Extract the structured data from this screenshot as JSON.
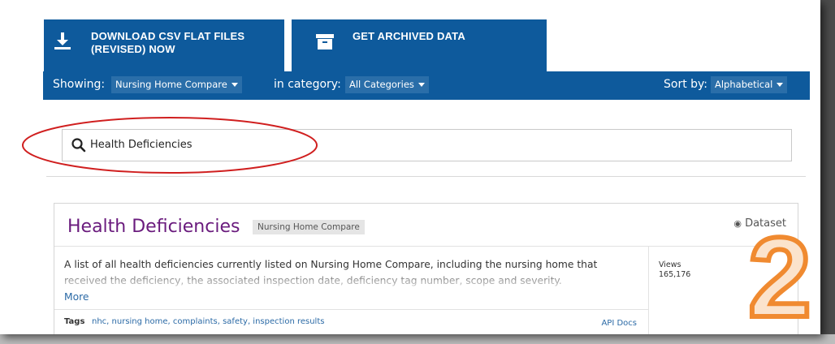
{
  "buttons": {
    "download_line1": "DOWNLOAD CSV FLAT FILES",
    "download_line2": "(REVISED) NOW",
    "archived": "GET ARCHIVED DATA"
  },
  "filter_bar": {
    "showing_label": "Showing:",
    "showing_value": "Nursing Home Compare",
    "category_label": "in category:",
    "category_value": "All Categories",
    "sort_label": "Sort by:",
    "sort_value": "Alphabetical"
  },
  "search": {
    "value": "Health Deficiencies"
  },
  "result": {
    "title": "Health Deficiencies",
    "tag": "Nursing Home Compare",
    "type": "Dataset",
    "description": "A list of all health deficiencies currently listed on Nursing Home Compare, including the nursing home that received the deficiency, the associated inspection date, deficiency tag number, scope and severity.",
    "more": "More",
    "views_label": "Views",
    "views_value": "165,176",
    "tags_label": "Tags",
    "tags_value": "nhc, nursing home, complaints, safety, inspection results",
    "api_docs": "API Docs"
  },
  "annotation": {
    "step_number": "2"
  },
  "colors": {
    "primary_blue": "#0e5a9c",
    "title_purple": "#6a1b7d",
    "link_blue": "#2b6aa6",
    "highlight_red": "#d01f1f",
    "step_orange": "#f08a30"
  }
}
